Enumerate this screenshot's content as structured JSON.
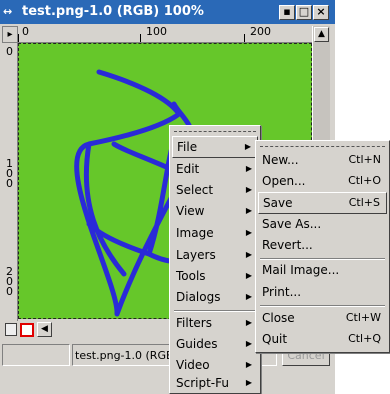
{
  "window": {
    "title": "test.png-1.0 (RGB) 100%",
    "sysicon": "↔",
    "buttons": {
      "minimize": "▪",
      "maximize": "□",
      "close": "×"
    }
  },
  "rulers": {
    "top_labels": [
      "0",
      "100",
      "200"
    ],
    "left_labels": [
      "0",
      "1",
      "0",
      "0",
      "2",
      "0",
      "0"
    ]
  },
  "canvas": {
    "color": "#66c72a",
    "stroke_color": "#2a2ad8"
  },
  "status": {
    "title": "test.png-1.0 (RGB)",
    "cancel": "Cancel"
  },
  "menu": {
    "items": [
      {
        "label": "File",
        "has_submenu": true,
        "selected": true
      },
      {
        "label": "Edit",
        "has_submenu": true
      },
      {
        "label": "Select",
        "has_submenu": true
      },
      {
        "label": "View",
        "has_submenu": true
      },
      {
        "label": "Image",
        "has_submenu": true
      },
      {
        "label": "Layers",
        "has_submenu": true
      },
      {
        "label": "Tools",
        "has_submenu": true
      },
      {
        "label": "Dialogs",
        "has_submenu": true
      },
      {
        "label": "Filters",
        "has_submenu": true
      },
      {
        "label": "Guides",
        "has_submenu": true
      },
      {
        "label": "Video",
        "has_submenu": true
      },
      {
        "label": "Script-Fu",
        "has_submenu": true
      }
    ]
  },
  "file_menu": {
    "items": [
      {
        "label": "New...",
        "shortcut": "Ctl+N"
      },
      {
        "label": "Open...",
        "shortcut": "Ctl+O"
      },
      {
        "label": "Save",
        "shortcut": "Ctl+S",
        "selected": true
      },
      {
        "label": "Save As...",
        "shortcut": ""
      },
      {
        "label": "Revert...",
        "shortcut": ""
      },
      {
        "label": "Mail Image...",
        "shortcut": ""
      },
      {
        "label": "Print...",
        "shortcut": ""
      },
      {
        "label": "Close",
        "shortcut": "Ctl+W"
      },
      {
        "label": "Quit",
        "shortcut": "Ctl+Q"
      }
    ]
  }
}
